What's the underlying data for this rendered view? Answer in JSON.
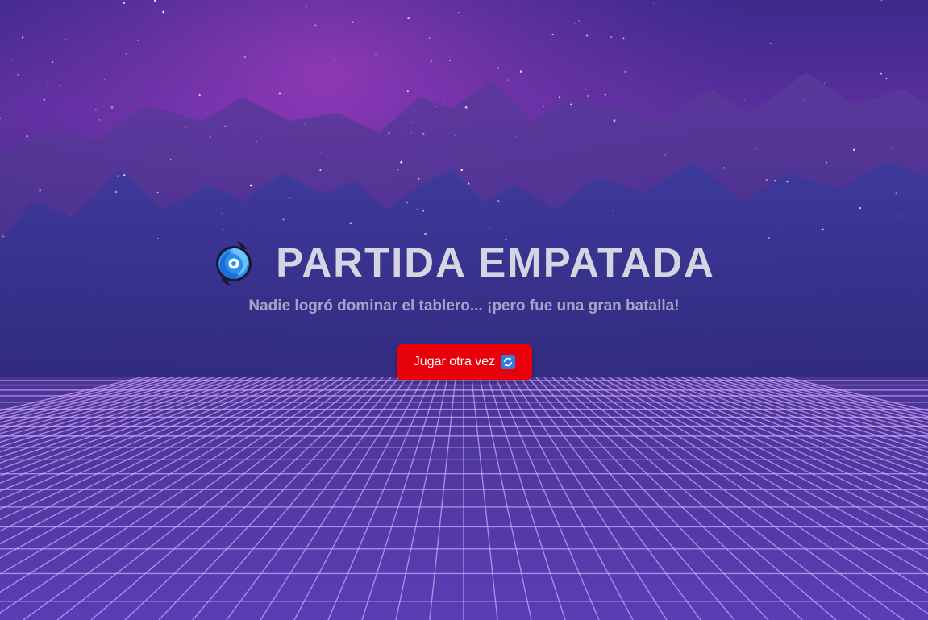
{
  "screen": {
    "title": "PARTIDA EMPATADA",
    "title_icon": "cyclone-icon",
    "subtitle": "Nadie logró dominar el tablero... ¡pero fue una gran batalla!",
    "replay_button": {
      "label": "Jugar otra vez",
      "icon": "repeat-icon"
    }
  },
  "colors": {
    "title_text": "#d4d4e2",
    "subtitle_text": "#a8a2c6",
    "button_bg": "#e8000a",
    "button_text": "#ffffff",
    "grid_line": "#d7a9ff",
    "sky_top": "#3a2a8a",
    "sky_mid": "#6b2fa0"
  }
}
